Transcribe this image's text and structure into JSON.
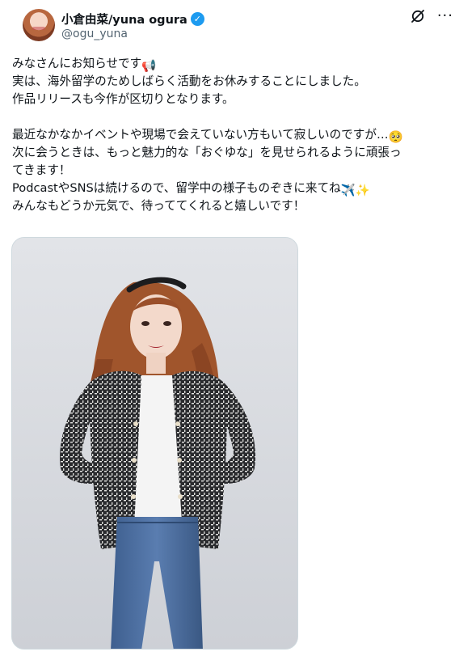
{
  "post": {
    "author": {
      "display_name": "小倉由菜/yuna ogura",
      "handle": "@ogu_yuna",
      "verified": true,
      "verified_color": "#1d9bf0"
    },
    "icons": {
      "verified": "verified-badge-icon",
      "grok": "grok-icon",
      "more": "more-options-icon"
    },
    "text_lines": [
      "みなさんにお知らせです",
      "実は、海外留学のためしばらく活動をお休みすることにしました。",
      "作品リリースも今作が区切りとなります。",
      "",
      "最近なかなかイベントや現場で会えていない方もいて寂しいのですが…",
      "次に会うときは、もっと魅力的な「おぐゆな」を見せられるように頑張っ",
      "てきます！",
      "PodcastやSNSは続けるので、留学中の様子ものぞきに来てね",
      "みんなもどうか元気で、待っててくれると嬉しいです！"
    ],
    "emojis": {
      "megaphone": "📢",
      "pleading": "🥺",
      "airplane": "✈️",
      "sparkles": "✨"
    },
    "media": {
      "type": "photo",
      "description_icon": "photo-image"
    }
  }
}
